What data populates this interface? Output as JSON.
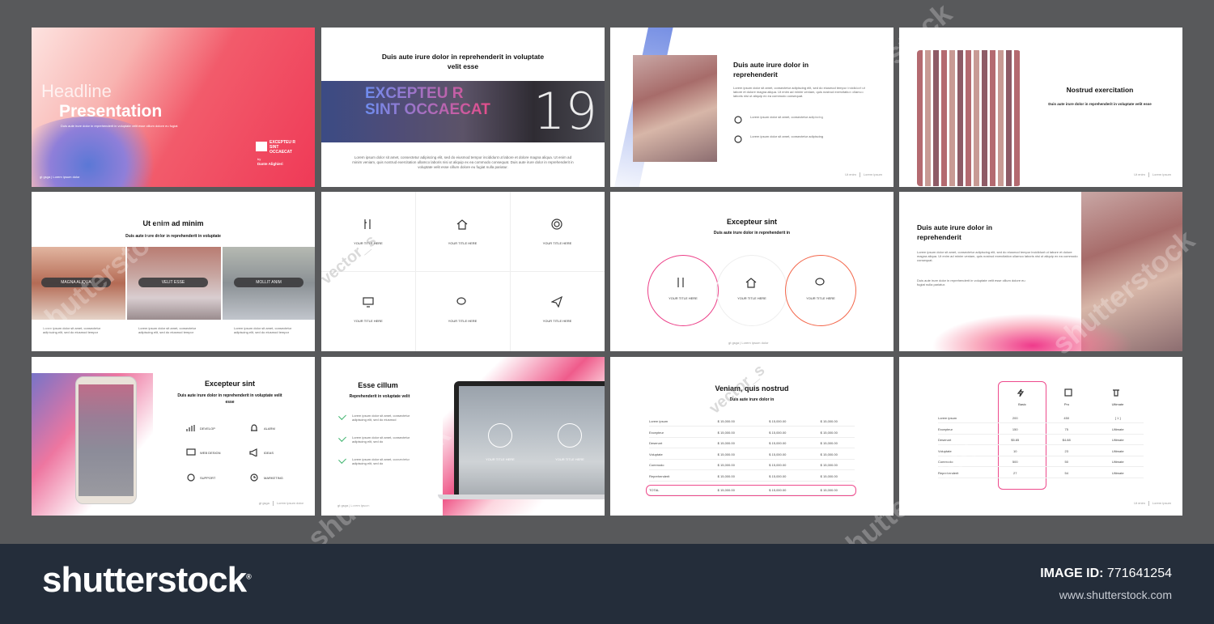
{
  "slide1": {
    "headline": "Headline",
    "presentation": "Presentation",
    "sub": "Duis aute irure dolor in reprehenderit in voluptate velit esse cillum dolore eu fugiat",
    "box": "EXCEPTEU R SINT OCCAECAT",
    "by": "by",
    "author": "Dante Alighieri",
    "footer_left": "gt gsga",
    "footer_right": "Lorem ipsum dolor"
  },
  "slide2": {
    "title": "Duis aute irure dolor in reprehenderit in voluptate velit esse",
    "banner": "EXCEPTEU R SINT OCCAECAT",
    "number": "19",
    "body": "Lorem ipsum dolor sit amet, consectetur adipiscing elit, sed do eiusmod tempor incididunt ut labore et dolore magna aliqua. Ut enim ad minim veniam, quis nostrud exercitation ullamco laboris nisi ut aliquip ex ea commodo consequat. Duis aute irure dolor in reprehenderit in voluptate velit esse cillum dolore eu fugiat nulla pariatur."
  },
  "slide3": {
    "title": "Duis aute irure dolor in reprehenderit",
    "body": "Lorem ipsum dolor sit amet, consectetur adipiscing elit, sed do eiusmod tempor incididunt ut labore et dolore magna aliqua. Ut enim ad minim veniam, quis nostrud exercitation ullamco laboris nisi ut aliquip ex ea commodo consequat.",
    "item1": "Lorem ipsum dolor sit amet, consectetur adipiscing",
    "item2": "Lorem ipsum dolor sit amet, consectetur adipiscing",
    "footer_left": "Ut enim",
    "footer_right": "Lorem ipsum"
  },
  "slide4": {
    "title": "Nostrud exercitation",
    "sub": "Duis aute irure dolor in reprehenderit in voluptate velit esse",
    "footer_left": "Ut enim",
    "footer_right": "Lorem ipsum"
  },
  "slide5": {
    "title": "Ut enim ad minim",
    "sub": "Duis aute irure dolor in reprehenderit in voluptate",
    "pill1": "MAGNA ALIQUA",
    "pill2": "VELIT ESSE",
    "pill3": "MOLLIT ANIM",
    "col1": "Lorem ipsum dolor sit amet, consectetur adipiscing elit, sed do eiusmod tempor",
    "col2": "Lorem ipsum dolor sit amet, consectetur adipiscing elit, sed do eiusmod tempor",
    "col3": "Lorem ipsum dolor sit amet, consectetur adipiscing elit, sed do eiusmod tempor"
  },
  "slide6": {
    "c1": "YOUR TITLE HERE",
    "c2": "YOUR TITLE HERE",
    "c3": "YOUR TITLE HERE",
    "c4": "YOUR TITLE HERE",
    "c5": "YOUR TITLE HERE",
    "c6": "YOUR TITLE HERE"
  },
  "slide7": {
    "title": "Excepteur sint",
    "sub": "Duis aute irure dolor in reprehenderit in",
    "c1": "YOUR TITLE HERE",
    "c2": "YOUR TITLE HERE",
    "c3": "YOUR TITLE HERE",
    "footer_left": "gt gsga",
    "footer_right": "Lorem ipsum dolor"
  },
  "slide8": {
    "title": "Duis aute irure dolor in reprehenderit",
    "body1": "Lorem ipsum dolor sit amet, consectetur adipiscing elit, sed do eiusmod tempor incididunt ut labore et dolore magna aliqua. Ut enim ad minim veniam, quis nostrud exercitation ullamco laboris nisi ut aliquip ex ea commodo consequat.",
    "body2": "Duis aute irure dolor in reprehenderit in voluptate velit esse cillum dolore eu fugiat nulla pariatur."
  },
  "slide9": {
    "title": "Excepteur sint",
    "sub": "Duis aute irure dolor in reprehenderit in voluptate velit esse",
    "f1": "DEVELOP",
    "f2": "ALARM",
    "f3": "WEB DESIGN",
    "f4": "IDEAS",
    "f5": "SUPPORT",
    "f6": "MARKETING",
    "footer_left": "gt gsga",
    "footer_right": "Lorem ipsum dolor"
  },
  "slide10": {
    "title": "Esse cillum",
    "sub": "Reprehenderit in voluptate velit",
    "i1": "Lorem ipsum dolor sit amet, consectetur adipiscing elit, sed do eiusmod",
    "i2": "Lorem ipsum dolor sit amet, consectetur adipiscing elit, sed do",
    "i3": "Lorem ipsum dolor sit amet, consectetur adipiscing elit, sed do",
    "s1": "YOUR TITLE HERE",
    "s2": "YOUR TITLE HERE",
    "footer_left": "gt gsga",
    "footer_right": "Lorem ipsum"
  },
  "slide11": {
    "title": "Veniam, quis nostrud",
    "sub": "Duis aute irure dolor in",
    "rows": [
      [
        "Lorem ipsum",
        "$ 15,000.00",
        "$ 15,000.00",
        "$ 15,000.00"
      ],
      [
        "Excepteur",
        "$ 15,000.00",
        "$ 15,000.00",
        "$ 15,000.00"
      ],
      [
        "Deserunt",
        "$ 15,000.00",
        "$ 15,000.00",
        "$ 15,000.00"
      ],
      [
        "Voluptate",
        "$ 15,000.00",
        "$ 15,000.00",
        "$ 15,000.00"
      ],
      [
        "Commodo",
        "$ 15,000.00",
        "$ 15,000.00",
        "$ 15,000.00"
      ],
      [
        "Reprehenderit",
        "$ 15,000.00",
        "$ 15,000.00",
        "$ 15,000.00"
      ]
    ],
    "total": [
      "TOTAL",
      "$ 15,000.00",
      "$ 15,000.00",
      "$ 15,000.00"
    ]
  },
  "slide12": {
    "h1": "Basic",
    "h2": "Pro",
    "h3": "Ultimate",
    "rows": [
      [
        "Lorem ipsum",
        "200",
        "450",
        "[ 1 ]"
      ],
      [
        "Excepteur",
        "150",
        "75",
        "Ultimate"
      ],
      [
        "Deserunt",
        "$5.85",
        "$4.88",
        "Ultimate"
      ],
      [
        "Voluptate",
        "10",
        "23",
        "Ultimate"
      ],
      [
        "Commodo",
        "500",
        "50",
        "Ultimate"
      ],
      [
        "Reprehenderit",
        "27",
        "54",
        "Ultimate"
      ]
    ],
    "footer_left": "Ut enim",
    "footer_right": "Lorem ipsum"
  },
  "footer": {
    "logo": "shutterstock",
    "image_id_label": "IMAGE ID:",
    "image_id": "771641254",
    "url": "www.shutterstock.com"
  },
  "watermark": {
    "a": "shutterstock",
    "b": "vector_s"
  }
}
